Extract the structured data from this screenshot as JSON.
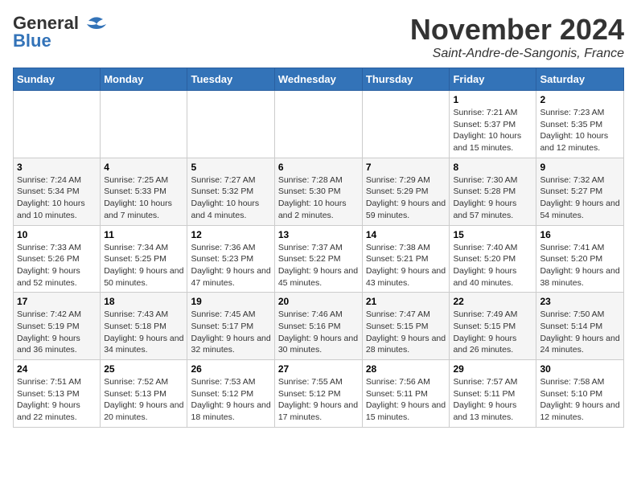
{
  "header": {
    "logo_general": "General",
    "logo_blue": "Blue",
    "month_title": "November 2024",
    "location": "Saint-Andre-de-Sangonis, France"
  },
  "calendar": {
    "weekdays": [
      "Sunday",
      "Monday",
      "Tuesday",
      "Wednesday",
      "Thursday",
      "Friday",
      "Saturday"
    ],
    "weeks": [
      [
        {
          "day": "",
          "info": ""
        },
        {
          "day": "",
          "info": ""
        },
        {
          "day": "",
          "info": ""
        },
        {
          "day": "",
          "info": ""
        },
        {
          "day": "",
          "info": ""
        },
        {
          "day": "1",
          "info": "Sunrise: 7:21 AM\nSunset: 5:37 PM\nDaylight: 10 hours and 15 minutes."
        },
        {
          "day": "2",
          "info": "Sunrise: 7:23 AM\nSunset: 5:35 PM\nDaylight: 10 hours and 12 minutes."
        }
      ],
      [
        {
          "day": "3",
          "info": "Sunrise: 7:24 AM\nSunset: 5:34 PM\nDaylight: 10 hours and 10 minutes."
        },
        {
          "day": "4",
          "info": "Sunrise: 7:25 AM\nSunset: 5:33 PM\nDaylight: 10 hours and 7 minutes."
        },
        {
          "day": "5",
          "info": "Sunrise: 7:27 AM\nSunset: 5:32 PM\nDaylight: 10 hours and 4 minutes."
        },
        {
          "day": "6",
          "info": "Sunrise: 7:28 AM\nSunset: 5:30 PM\nDaylight: 10 hours and 2 minutes."
        },
        {
          "day": "7",
          "info": "Sunrise: 7:29 AM\nSunset: 5:29 PM\nDaylight: 9 hours and 59 minutes."
        },
        {
          "day": "8",
          "info": "Sunrise: 7:30 AM\nSunset: 5:28 PM\nDaylight: 9 hours and 57 minutes."
        },
        {
          "day": "9",
          "info": "Sunrise: 7:32 AM\nSunset: 5:27 PM\nDaylight: 9 hours and 54 minutes."
        }
      ],
      [
        {
          "day": "10",
          "info": "Sunrise: 7:33 AM\nSunset: 5:26 PM\nDaylight: 9 hours and 52 minutes."
        },
        {
          "day": "11",
          "info": "Sunrise: 7:34 AM\nSunset: 5:25 PM\nDaylight: 9 hours and 50 minutes."
        },
        {
          "day": "12",
          "info": "Sunrise: 7:36 AM\nSunset: 5:23 PM\nDaylight: 9 hours and 47 minutes."
        },
        {
          "day": "13",
          "info": "Sunrise: 7:37 AM\nSunset: 5:22 PM\nDaylight: 9 hours and 45 minutes."
        },
        {
          "day": "14",
          "info": "Sunrise: 7:38 AM\nSunset: 5:21 PM\nDaylight: 9 hours and 43 minutes."
        },
        {
          "day": "15",
          "info": "Sunrise: 7:40 AM\nSunset: 5:20 PM\nDaylight: 9 hours and 40 minutes."
        },
        {
          "day": "16",
          "info": "Sunrise: 7:41 AM\nSunset: 5:20 PM\nDaylight: 9 hours and 38 minutes."
        }
      ],
      [
        {
          "day": "17",
          "info": "Sunrise: 7:42 AM\nSunset: 5:19 PM\nDaylight: 9 hours and 36 minutes."
        },
        {
          "day": "18",
          "info": "Sunrise: 7:43 AM\nSunset: 5:18 PM\nDaylight: 9 hours and 34 minutes."
        },
        {
          "day": "19",
          "info": "Sunrise: 7:45 AM\nSunset: 5:17 PM\nDaylight: 9 hours and 32 minutes."
        },
        {
          "day": "20",
          "info": "Sunrise: 7:46 AM\nSunset: 5:16 PM\nDaylight: 9 hours and 30 minutes."
        },
        {
          "day": "21",
          "info": "Sunrise: 7:47 AM\nSunset: 5:15 PM\nDaylight: 9 hours and 28 minutes."
        },
        {
          "day": "22",
          "info": "Sunrise: 7:49 AM\nSunset: 5:15 PM\nDaylight: 9 hours and 26 minutes."
        },
        {
          "day": "23",
          "info": "Sunrise: 7:50 AM\nSunset: 5:14 PM\nDaylight: 9 hours and 24 minutes."
        }
      ],
      [
        {
          "day": "24",
          "info": "Sunrise: 7:51 AM\nSunset: 5:13 PM\nDaylight: 9 hours and 22 minutes."
        },
        {
          "day": "25",
          "info": "Sunrise: 7:52 AM\nSunset: 5:13 PM\nDaylight: 9 hours and 20 minutes."
        },
        {
          "day": "26",
          "info": "Sunrise: 7:53 AM\nSunset: 5:12 PM\nDaylight: 9 hours and 18 minutes."
        },
        {
          "day": "27",
          "info": "Sunrise: 7:55 AM\nSunset: 5:12 PM\nDaylight: 9 hours and 17 minutes."
        },
        {
          "day": "28",
          "info": "Sunrise: 7:56 AM\nSunset: 5:11 PM\nDaylight: 9 hours and 15 minutes."
        },
        {
          "day": "29",
          "info": "Sunrise: 7:57 AM\nSunset: 5:11 PM\nDaylight: 9 hours and 13 minutes."
        },
        {
          "day": "30",
          "info": "Sunrise: 7:58 AM\nSunset: 5:10 PM\nDaylight: 9 hours and 12 minutes."
        }
      ]
    ]
  }
}
